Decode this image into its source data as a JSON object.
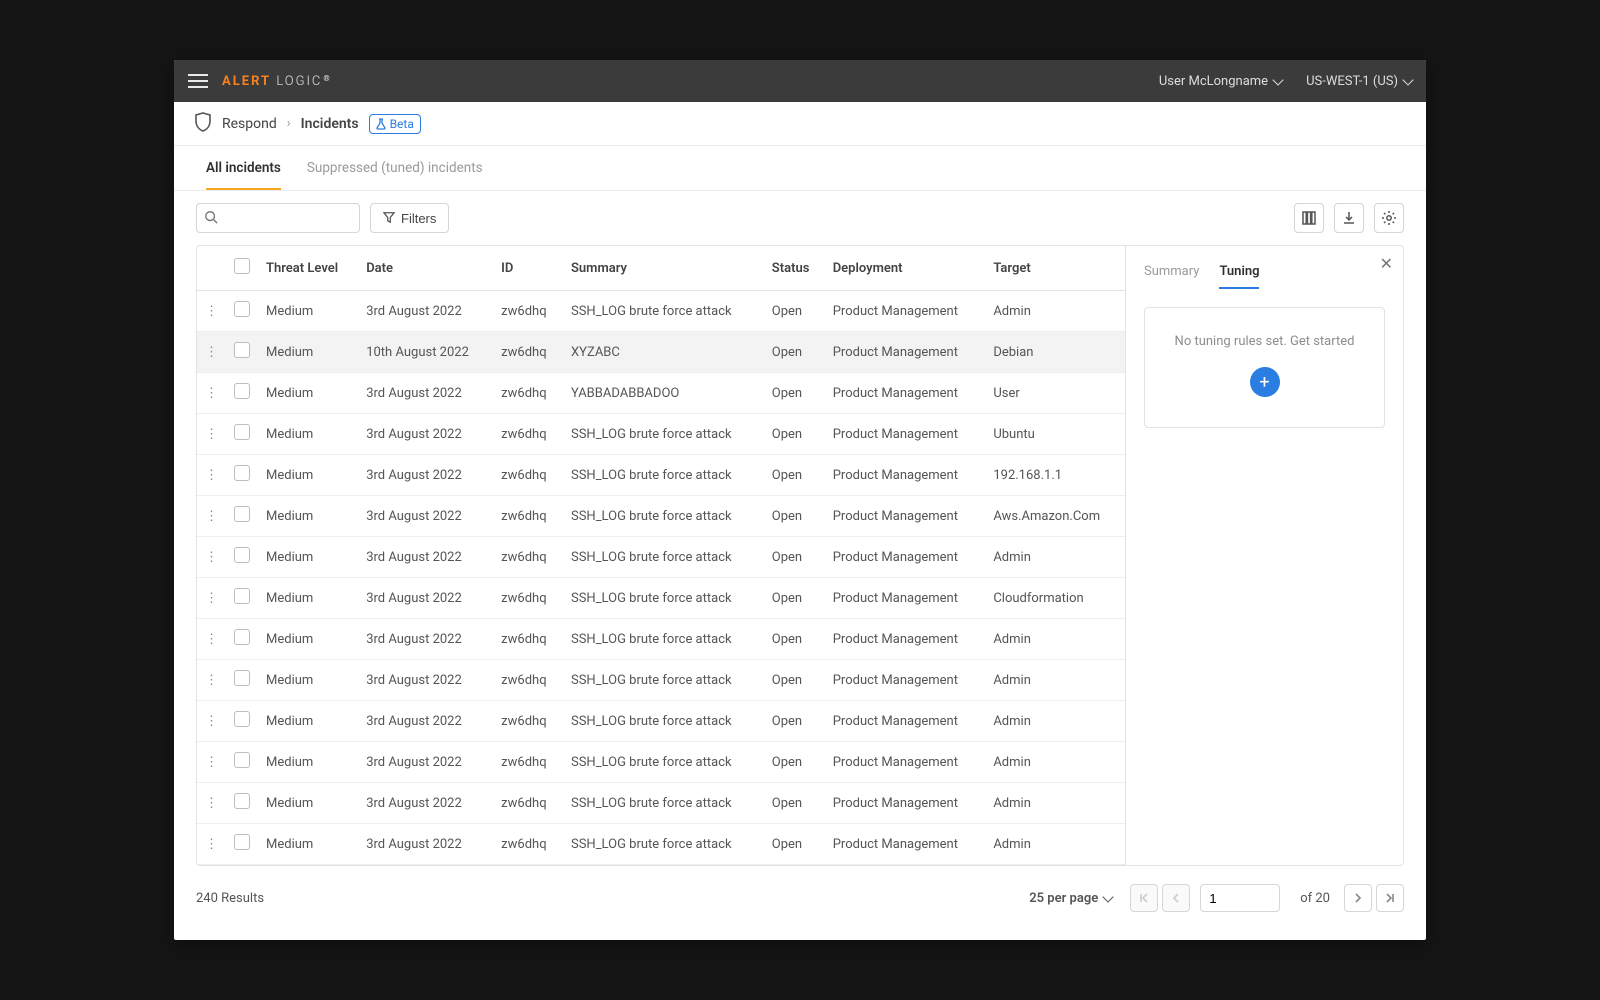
{
  "topbar": {
    "brand_prefix": "ALERT",
    "brand_suffix": "LOGIC",
    "user": "User McLongname",
    "region": "US-WEST-1 (US)"
  },
  "breadcrumb": {
    "root": "Respond",
    "page": "Incidents",
    "badge": "Beta"
  },
  "tabs": {
    "items": [
      {
        "label": "All incidents",
        "active": true
      },
      {
        "label": "Suppressed (tuned) incidents",
        "active": false
      }
    ]
  },
  "toolbar": {
    "search_placeholder": "",
    "filters_label": "Filters"
  },
  "table": {
    "columns": [
      "Threat Level",
      "Date",
      "ID",
      "Summary",
      "Status",
      "Deployment",
      "Target"
    ],
    "rows": [
      {
        "threat": "Medium",
        "date": "3rd August 2022",
        "id": "zw6dhq",
        "summary": "SSH_LOG brute force attack",
        "status": "Open",
        "deployment": "Product Management",
        "target": "Admin",
        "selected": false
      },
      {
        "threat": "Medium",
        "date": "10th August 2022",
        "id": "zw6dhq",
        "summary": "XYZABC",
        "status": "Open",
        "deployment": "Product Management",
        "target": "Debian",
        "selected": true
      },
      {
        "threat": "Medium",
        "date": "3rd August 2022",
        "id": "zw6dhq",
        "summary": "YABBADABBADOO",
        "status": "Open",
        "deployment": "Product Management",
        "target": "User",
        "selected": false
      },
      {
        "threat": "Medium",
        "date": "3rd August 2022",
        "id": "zw6dhq",
        "summary": "SSH_LOG brute force attack",
        "status": "Open",
        "deployment": "Product Management",
        "target": "Ubuntu",
        "selected": false
      },
      {
        "threat": "Medium",
        "date": "3rd August 2022",
        "id": "zw6dhq",
        "summary": "SSH_LOG brute force attack",
        "status": "Open",
        "deployment": "Product Management",
        "target": "192.168.1.1",
        "selected": false
      },
      {
        "threat": "Medium",
        "date": "3rd August 2022",
        "id": "zw6dhq",
        "summary": "SSH_LOG brute force attack",
        "status": "Open",
        "deployment": "Product Management",
        "target": "Aws.Amazon.Com",
        "selected": false
      },
      {
        "threat": "Medium",
        "date": "3rd August 2022",
        "id": "zw6dhq",
        "summary": "SSH_LOG brute force attack",
        "status": "Open",
        "deployment": "Product Management",
        "target": "Admin",
        "selected": false
      },
      {
        "threat": "Medium",
        "date": "3rd August 2022",
        "id": "zw6dhq",
        "summary": "SSH_LOG brute force attack",
        "status": "Open",
        "deployment": "Product Management",
        "target": "Cloudformation",
        "selected": false
      },
      {
        "threat": "Medium",
        "date": "3rd August 2022",
        "id": "zw6dhq",
        "summary": "SSH_LOG brute force attack",
        "status": "Open",
        "deployment": "Product Management",
        "target": "Admin",
        "selected": false
      },
      {
        "threat": "Medium",
        "date": "3rd August 2022",
        "id": "zw6dhq",
        "summary": "SSH_LOG brute force attack",
        "status": "Open",
        "deployment": "Product Management",
        "target": "Admin",
        "selected": false
      },
      {
        "threat": "Medium",
        "date": "3rd August 2022",
        "id": "zw6dhq",
        "summary": "SSH_LOG brute force attack",
        "status": "Open",
        "deployment": "Product Management",
        "target": "Admin",
        "selected": false
      },
      {
        "threat": "Medium",
        "date": "3rd August 2022",
        "id": "zw6dhq",
        "summary": "SSH_LOG brute force attack",
        "status": "Open",
        "deployment": "Product Management",
        "target": "Admin",
        "selected": false
      },
      {
        "threat": "Medium",
        "date": "3rd August 2022",
        "id": "zw6dhq",
        "summary": "SSH_LOG brute force attack",
        "status": "Open",
        "deployment": "Product Management",
        "target": "Admin",
        "selected": false
      },
      {
        "threat": "Medium",
        "date": "3rd August 2022",
        "id": "zw6dhq",
        "summary": "SSH_LOG brute force attack",
        "status": "Open",
        "deployment": "Product Management",
        "target": "Admin",
        "selected": false
      }
    ]
  },
  "panel": {
    "tabs": [
      {
        "label": "Summary",
        "active": false
      },
      {
        "label": "Tuning",
        "active": true
      }
    ],
    "empty_text": "No tuning rules set. Get started"
  },
  "footer": {
    "results": "240 Results",
    "perpage": "25 per page",
    "page": "1",
    "of_label": "of 20"
  }
}
